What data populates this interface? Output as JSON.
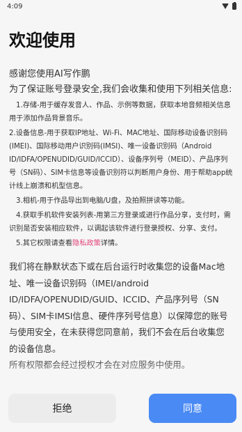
{
  "status_bar": {
    "time": "4:09"
  },
  "title": "欢迎使用",
  "intro": "感谢您使用AI写作鹏",
  "intro2": "为了保证账号登录安全,我们会收集和使用下列相关信息:",
  "items": [
    "1.存储-用于缓存发音人、作品、示例等数据，获取本地音频相关信息用于添加作品背景音乐。",
    "2.设备信息-用于获取IP地址、Wi-Fi、MAC地址、国际移动设备识别码(IMEI)、国际移动用户识别码(IMSI)、唯一设备识别码（Android ID/IDFA/OPENUDID/GUID/ICCID）、设备序列号（MEID）、产品序列号（SN码）、SIM卡信息等设备识别符以判断用户身份、用于帮助app统计线上崩溃和机型信息。",
    "3.相机-用于作品导出到电脑/U盘，及拍照拼读等功能。",
    "4.获取手机软件安装列表-用第三方登录或进行作品分享，支付时，需识别是否安装相应软件，以调起该软件进行登录授权、分享、支付。"
  ],
  "item5": {
    "prefix": "5.其它权限请查看",
    "link": "隐私政策",
    "suffix": "详情。"
  },
  "background_notice": "我们将在静默状态下或在后台运行时收集您的设备Mac地址、唯一设备识别码（IMEI/android ID/IDFA/OPENUDID/GUID、ICCID、产品序列号（SN码）、SIM卡IMSI信息、硬件序列号信息）以保障您的账号与使用安全，在未获得您同意前，我们不会在后台收集您的设备信息。",
  "cut_off_text": "所有权限都会经过授权才会在对应服务中使用。",
  "buttons": {
    "reject": "拒绝",
    "agree": "同意"
  }
}
